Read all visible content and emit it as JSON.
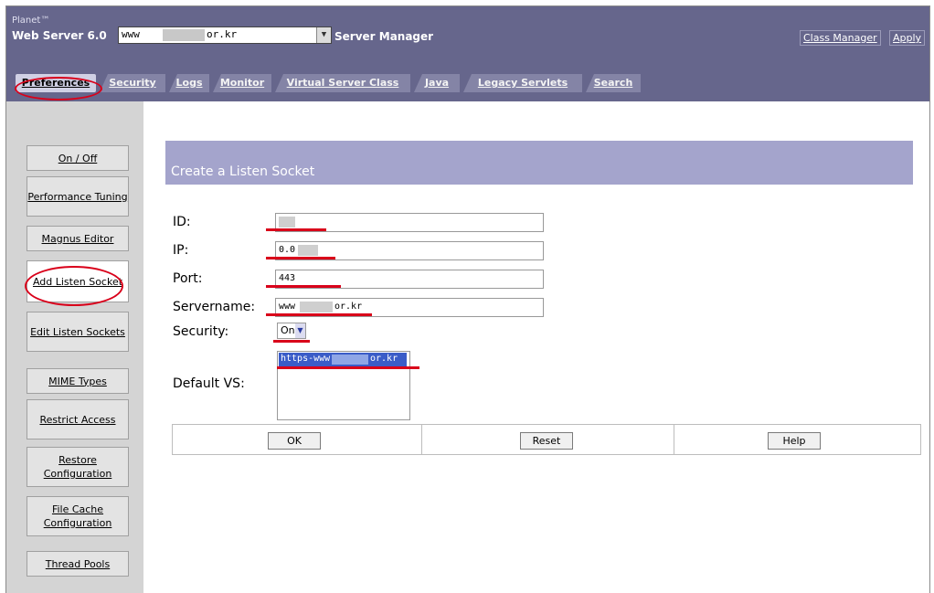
{
  "header": {
    "brand_line1": "Planet™",
    "brand_line2": "Web Server 6.0",
    "server_prefix": "www",
    "server_suffix": "or.kr",
    "server_manager": "Server Manager",
    "class_manager": "Class Manager",
    "apply": "Apply"
  },
  "tabs": [
    {
      "label": "Preferences",
      "active": true
    },
    {
      "label": "Security"
    },
    {
      "label": "Logs"
    },
    {
      "label": "Monitor"
    },
    {
      "label": "Virtual Server Class"
    },
    {
      "label": "Java"
    },
    {
      "label": "Legacy Servlets"
    },
    {
      "label": "Search"
    }
  ],
  "sidebar": {
    "items": [
      {
        "label": "On / Off"
      },
      {
        "label": "Performance Tuning"
      },
      {
        "label": "Magnus Editor"
      },
      {
        "label": "Add Listen Socket",
        "active": true
      },
      {
        "label": "Edit Listen Sockets"
      },
      {
        "label": "MIME Types"
      },
      {
        "label": "Restrict Access"
      },
      {
        "label": "Restore Configuration"
      },
      {
        "label": "File Cache Configuration"
      },
      {
        "label": "Thread Pools"
      }
    ]
  },
  "form": {
    "title": "Create a Listen Socket",
    "id_label": "ID:",
    "ip_label": "IP:",
    "ip_value": "0.0",
    "port_label": "Port:",
    "port_value": "443",
    "servername_label": "Servername:",
    "servername_prefix": "www",
    "servername_suffix": "or.kr",
    "security_label": "Security:",
    "security_value": "On",
    "default_vs_label": "Default VS:",
    "default_vs_prefix": "https-www",
    "default_vs_suffix": "or.kr"
  },
  "buttons": {
    "ok": "OK",
    "reset": "Reset",
    "help": "Help"
  },
  "colors": {
    "header_bg": "#66668c",
    "panel_title_bg": "#a4a4cc",
    "sidebar_bg": "#d4d4d4",
    "annotation_red": "#d9001a"
  }
}
